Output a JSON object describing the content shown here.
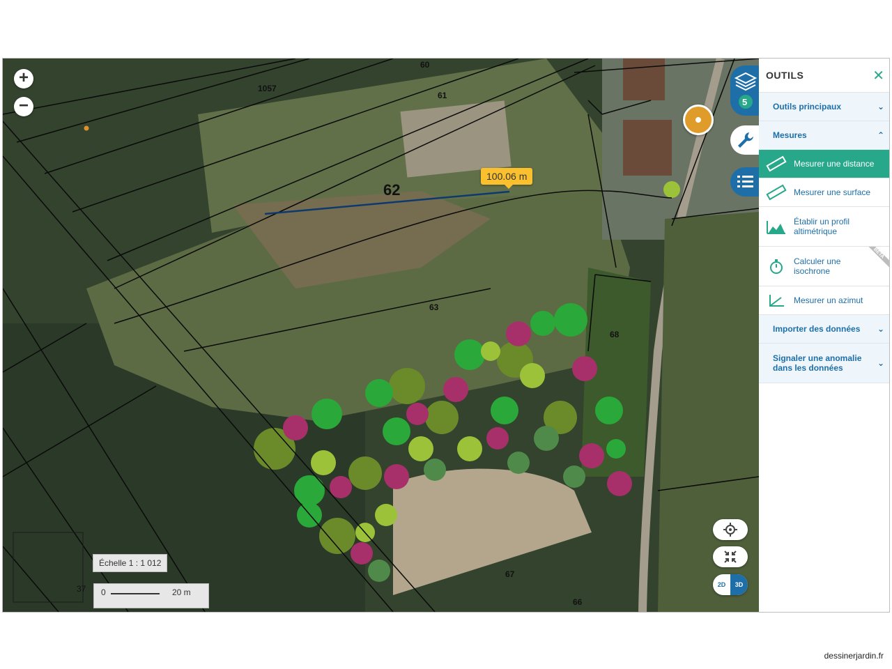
{
  "map": {
    "measure_label": "100.06 m",
    "parcels": {
      "p60": "60",
      "p1057": "1057",
      "p61": "61",
      "p62": "62",
      "p63": "63",
      "p68": "68",
      "p67": "67",
      "p66": "66",
      "p37": "37"
    },
    "scale_text": "Échelle 1 : 1 012",
    "scale_bar_start": "0",
    "scale_bar_end": "20 m",
    "zoom_in": "+",
    "zoom_out": "−",
    "layers_count": "5",
    "view_2d": "2D",
    "view_3d": "3D",
    "view_mode_active": "3D"
  },
  "panel": {
    "title": "OUTILS",
    "close": "✕",
    "sections": {
      "main_tools": "Outils principaux",
      "measures": "Mesures",
      "import": "Importer des données",
      "report": "Signaler une anomalie dans les données"
    },
    "items": {
      "distance": "Mesurer une distance",
      "surface": "Mesurer une surface",
      "profile": "Établir un profil altimétrique",
      "isochrone": "Calculer une isochrone",
      "azimuth": "Mesurer un azimut"
    },
    "beta": "BETA"
  },
  "credit": "dessinerjardin.fr",
  "colors": {
    "accent": "#27a88a",
    "brand": "#1e6fa8",
    "label": "#fbc02d"
  }
}
